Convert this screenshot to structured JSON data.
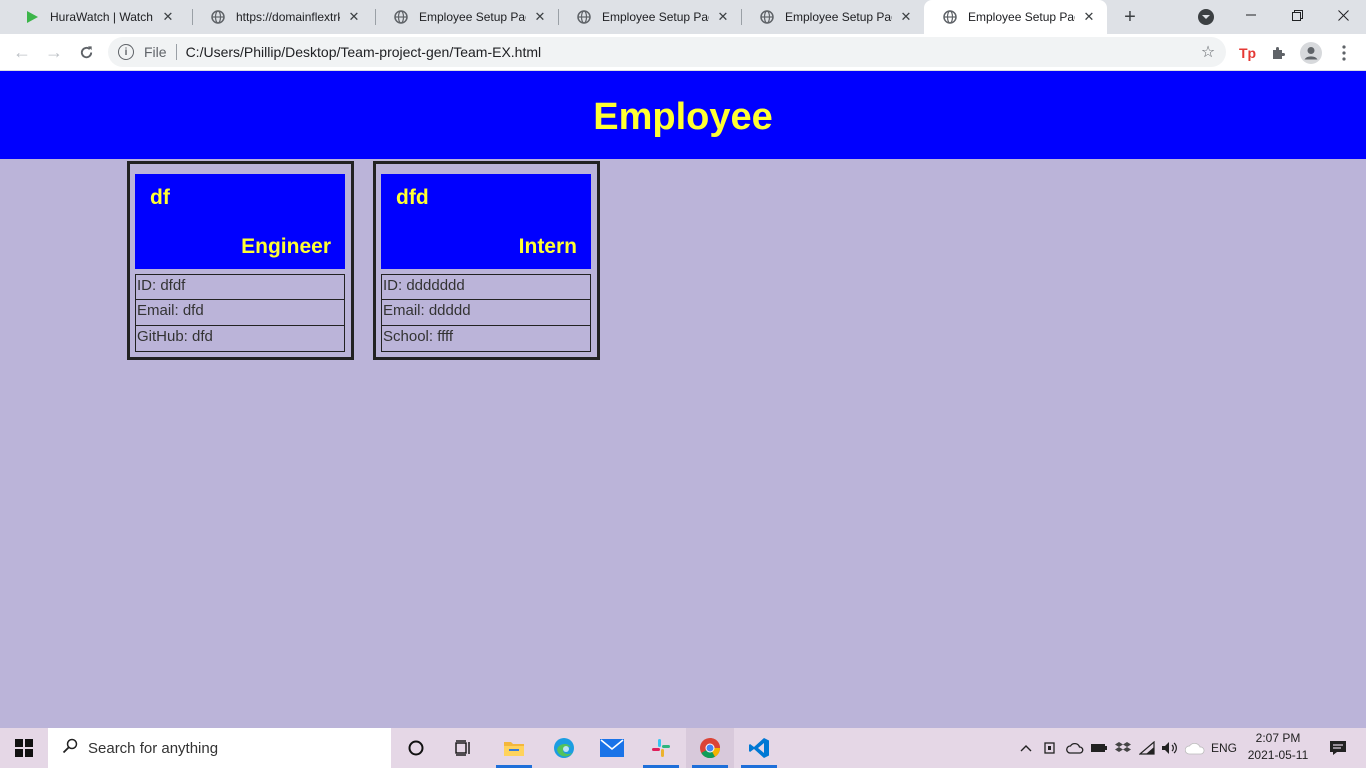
{
  "browser": {
    "tabs": [
      {
        "title": "HuraWatch | Watch Sta",
        "icon": "play-icon"
      },
      {
        "title": "https://domainflextrk.c",
        "icon": "globe-icon"
      },
      {
        "title": "Employee Setup Page",
        "icon": "globe-icon"
      },
      {
        "title": "Employee Setup Page",
        "icon": "globe-icon"
      },
      {
        "title": "Employee Setup Page",
        "icon": "globe-icon"
      },
      {
        "title": "Employee Setup Page",
        "icon": "globe-icon",
        "active": true
      }
    ],
    "scheme_label": "File",
    "url": "C:/Users/Phillip/Desktop/Team-project-gen/Team-EX.html"
  },
  "page": {
    "header_title": "Employee",
    "cards": [
      {
        "name": "df",
        "role": "Engineer",
        "rows": [
          "ID: dfdf",
          "Email: dfd",
          "GitHub: dfd"
        ]
      },
      {
        "name": "dfd",
        "role": "Intern",
        "rows": [
          "ID: ddddddd",
          "Email: ddddd",
          "School: ffff"
        ]
      }
    ]
  },
  "taskbar": {
    "search_placeholder": "Search for anything",
    "language": "ENG",
    "time": "2:07 PM",
    "date": "2021-05-11"
  },
  "colors": {
    "header_bg": "#0000ff",
    "header_text": "#ffff33",
    "page_bg": "#bbb4d9"
  }
}
